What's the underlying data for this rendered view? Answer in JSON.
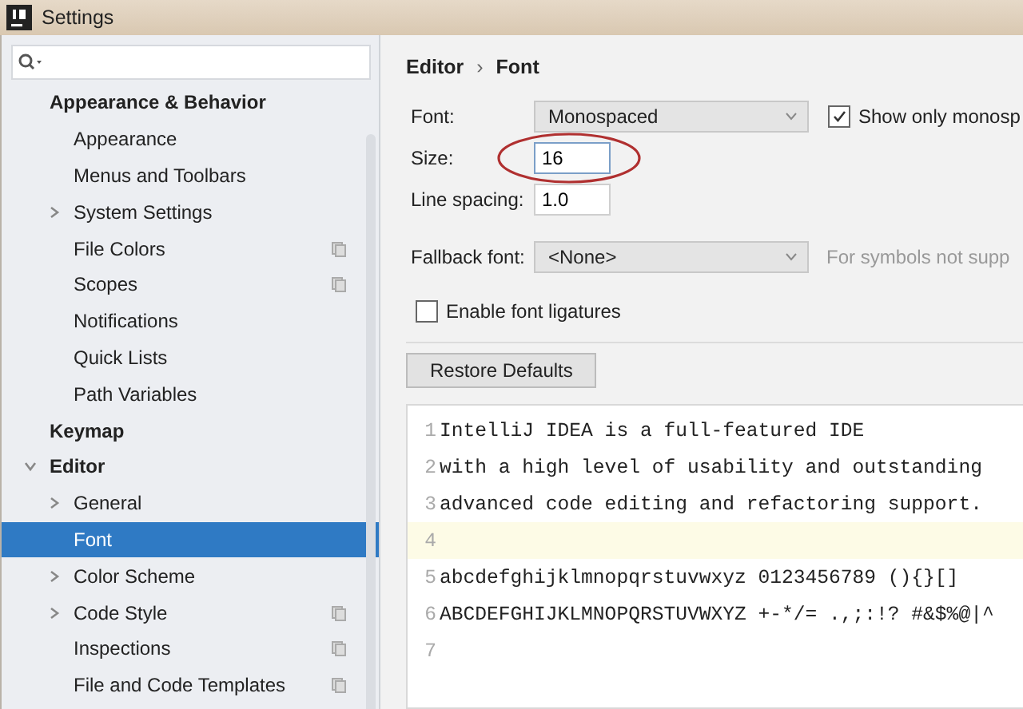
{
  "window": {
    "title": "Settings"
  },
  "sidebar": {
    "items": [
      {
        "label": "Appearance & Behavior",
        "kind": "item",
        "selected": false,
        "project_level": false,
        "children": [
          {
            "label": "Appearance",
            "kind": "item",
            "selected": false,
            "project_level": false
          },
          {
            "label": "Menus and Toolbars",
            "kind": "item",
            "selected": false,
            "project_level": false
          },
          {
            "label": "System Settings",
            "kind": "folder",
            "expanded": false,
            "selected": false,
            "project_level": false
          },
          {
            "label": "File Colors",
            "kind": "item",
            "selected": false,
            "project_level": true
          },
          {
            "label": "Scopes",
            "kind": "item",
            "selected": false,
            "project_level": true
          },
          {
            "label": "Notifications",
            "kind": "item",
            "selected": false,
            "project_level": false
          },
          {
            "label": "Quick Lists",
            "kind": "item",
            "selected": false,
            "project_level": false
          },
          {
            "label": "Path Variables",
            "kind": "item",
            "selected": false,
            "project_level": false
          }
        ]
      },
      {
        "label": "Keymap",
        "kind": "item",
        "selected": false,
        "project_level": false
      },
      {
        "label": "Editor",
        "kind": "folder",
        "expanded": true,
        "selected": false,
        "project_level": false,
        "children": [
          {
            "label": "General",
            "kind": "folder",
            "expanded": false,
            "selected": false,
            "project_level": false
          },
          {
            "label": "Font",
            "kind": "item",
            "selected": true,
            "project_level": false
          },
          {
            "label": "Color Scheme",
            "kind": "folder",
            "expanded": false,
            "selected": false,
            "project_level": false
          },
          {
            "label": "Code Style",
            "kind": "folder",
            "expanded": false,
            "selected": false,
            "project_level": true
          },
          {
            "label": "Inspections",
            "kind": "item",
            "selected": false,
            "project_level": true
          },
          {
            "label": "File and Code Templates",
            "kind": "item",
            "selected": false,
            "project_level": true
          }
        ]
      }
    ]
  },
  "breadcrumb": [
    "Editor",
    "›",
    "Font"
  ],
  "form": {
    "font": {
      "label": "Font:",
      "value": "Monospaced"
    },
    "show_only_monospaced": {
      "label": "Show only monosp",
      "checked": true
    },
    "size": {
      "label": "Size:",
      "value": "16",
      "highlighted": true
    },
    "line_spacing": {
      "label": "Line spacing:",
      "value": "1.0"
    },
    "fallback_font": {
      "label": "Fallback font:",
      "value": "<None>",
      "hint": "For symbols not supp"
    },
    "ligatures": {
      "label": "Enable font ligatures",
      "checked": false
    },
    "restore_button": "Restore Defaults"
  },
  "preview": {
    "lines": [
      {
        "number": "1",
        "text": "IntelliJ IDEA is a full-featured IDE",
        "current": false
      },
      {
        "number": "2",
        "text": "with a high level of usability and outstanding",
        "current": false
      },
      {
        "number": "3",
        "text": "advanced code editing and refactoring support.",
        "current": false
      },
      {
        "number": "4",
        "current": true
      },
      {
        "number": "5",
        "text": "abcdefghijklmnopqrstuvwxyz 0123456789 (){}[]",
        "current": false
      },
      {
        "number": "6",
        "text": "ABCDEFGHIJKLMNOPQRSTUVWXYZ +-*/= .,;:!? #&$%@|^",
        "current": false
      },
      {
        "number": "7",
        "current": false
      }
    ]
  }
}
